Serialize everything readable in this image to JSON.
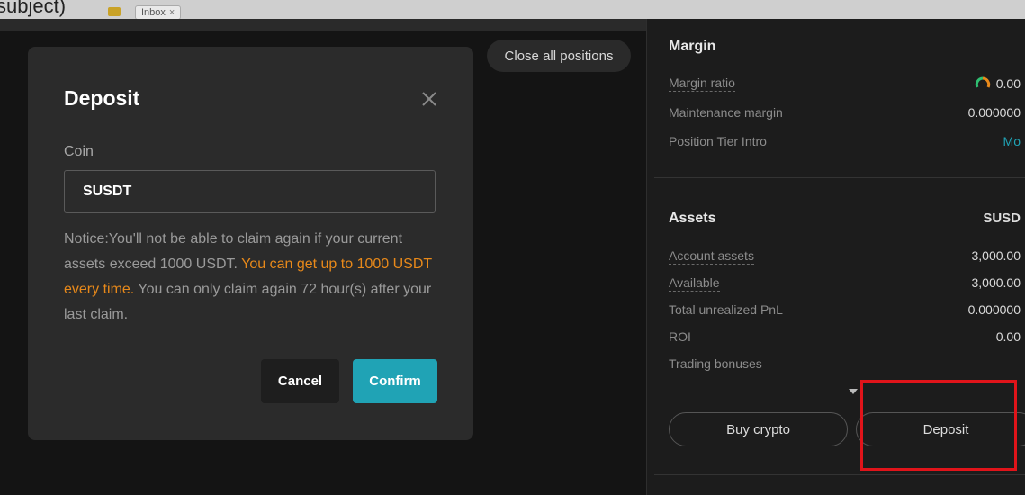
{
  "browser": {
    "subject_fragment": "subject)",
    "tab_label": "Inbox",
    "tab_close": "×"
  },
  "main": {
    "close_all_label": "Close all positions"
  },
  "modal": {
    "title": "Deposit",
    "coin_label": "Coin",
    "coin_value": "SUSDT",
    "notice_part1": "Notice:You'll not be able to claim again if your current assets exceed 1000 USDT. ",
    "notice_highlight": "You can get up to 1000 USDT every time.",
    "notice_part2": " You can only claim again 72 hour(s) after your last claim.",
    "cancel_label": "Cancel",
    "confirm_label": "Confirm"
  },
  "panel": {
    "margin_title": "Margin",
    "margin_ratio_label": "Margin ratio",
    "margin_ratio_value": "0.00",
    "maintenance_label": "Maintenance margin",
    "maintenance_value": "0.000000",
    "tier_label": "Position Tier Intro",
    "tier_link": "Mo",
    "assets_title": "Assets",
    "assets_currency": "SUSD",
    "account_assets_label": "Account assets",
    "account_assets_value": "3,000.00",
    "available_label": "Available",
    "available_value": "3,000.00",
    "unrealized_label": "Total unrealized PnL",
    "unrealized_value": "0.000000",
    "roi_label": "ROI",
    "roi_value": "0.00",
    "bonuses_label": "Trading bonuses",
    "buy_crypto_label": "Buy crypto",
    "deposit_label": "Deposit"
  },
  "colors": {
    "accent": "#20a3b5",
    "highlight_text": "#e8891a",
    "annotation_box": "#e0141a"
  }
}
